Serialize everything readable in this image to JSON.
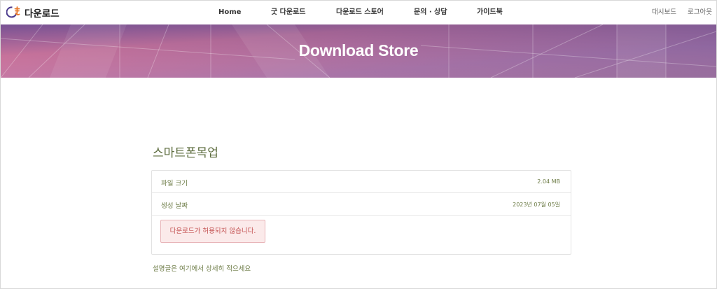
{
  "header": {
    "logo_text": "다운로드",
    "nav": [
      "Home",
      "굿 다운로드",
      "다운로드 스토어",
      "문의 · 상담",
      "가이드북"
    ],
    "right": [
      "대시보드",
      "로그아웃"
    ]
  },
  "hero": {
    "title": "Download Store"
  },
  "main": {
    "title": "스마트폰목업",
    "rows": [
      {
        "label": "파일 크기",
        "value": "2.04 MB"
      },
      {
        "label": "생성 날짜",
        "value": "2023년 07월 05일"
      }
    ],
    "alert": "다운로드가 허용되지 않습니다.",
    "description": "설명글은 여기에서 상세히 적으세요"
  },
  "colors": {
    "accent_text": "#5b6b3c",
    "alert_text": "#c24d4d",
    "alert_bg": "#fbeaea",
    "hero_pink": "#d9749a",
    "hero_purple": "#6c5e97"
  }
}
